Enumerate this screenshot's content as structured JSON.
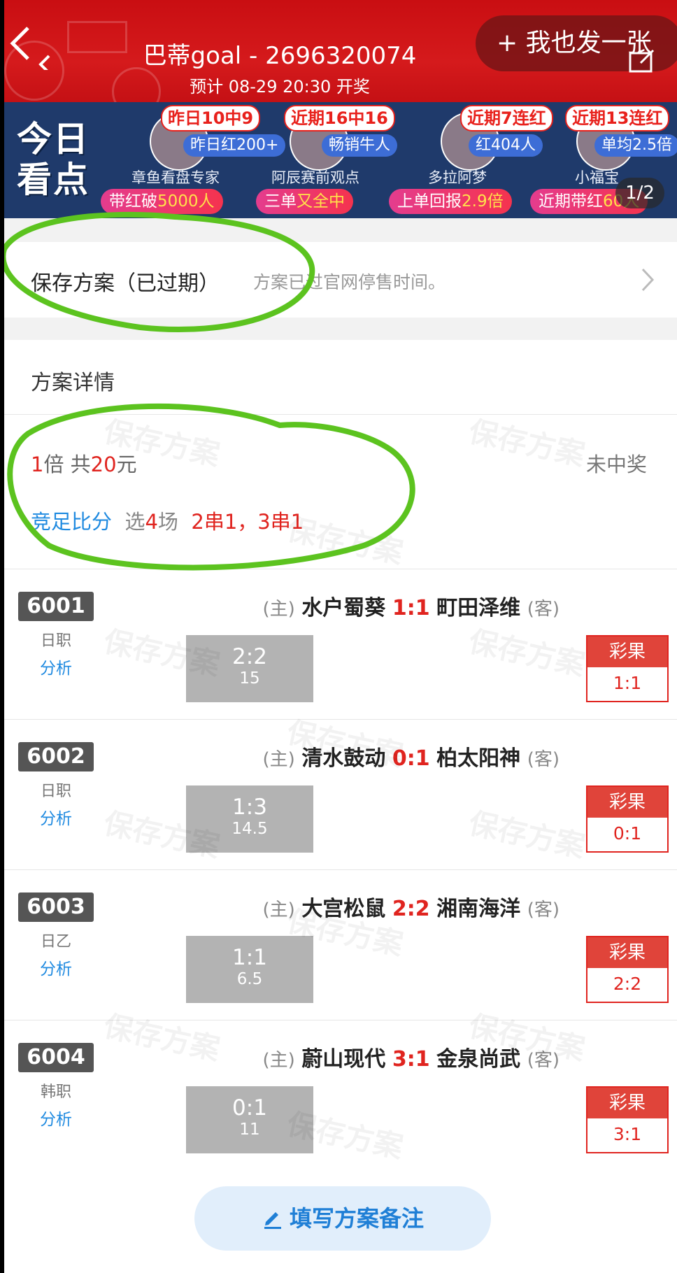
{
  "header": {
    "title": "巴蒂goal - 2696320074",
    "subtitle": "预计 08-29 20:30 开奖",
    "post_button": "+ 我也发一张"
  },
  "banner": {
    "headline_line1": "今日",
    "headline_line2": "看点",
    "experts": [
      {
        "tag": "昨日10中9",
        "stat": "昨日红200+",
        "name": "章鱼看盘专家"
      },
      {
        "tag": "近期16中16",
        "stat": "畅销牛人",
        "name": "阿辰赛前观点"
      },
      {
        "tag": "近期7连红",
        "stat": "红404人",
        "name": "多拉阿梦"
      },
      {
        "tag": "近期13连红",
        "stat": "单均2.5倍",
        "name": "小福宝"
      }
    ],
    "hot_tags": [
      {
        "pre": "带红破",
        "hl": "5000人"
      },
      {
        "pre": "三单",
        "hl": "又全中"
      },
      {
        "pre": "上单回报",
        "hl": "2.9倍"
      },
      {
        "pre": "近期带红",
        "hl": "60人"
      }
    ],
    "pager": "1/2"
  },
  "save": {
    "title": "保存方案（已过期）",
    "desc": "方案已过官网停售时间。"
  },
  "detail": {
    "title": "方案详情",
    "multiple": "1",
    "multiple_unit": "倍 共",
    "amount": "20",
    "amount_unit": "元",
    "status": "未中奖",
    "play_type": "竞足比分",
    "select_pre": "选",
    "select_count": "4",
    "select_unit": "场",
    "combos": "2串1，3串1"
  },
  "matches": [
    {
      "code": "6001",
      "league": "日职",
      "analysis": "分析",
      "home_tag": "(主)",
      "home": "水户蜀葵",
      "score": "1:1",
      "away": "町田泽维",
      "away_tag": "(客)",
      "pick_score": "2:2",
      "pick_odds": "15",
      "result_label": "彩果",
      "result": "1:1"
    },
    {
      "code": "6002",
      "league": "日职",
      "analysis": "分析",
      "home_tag": "(主)",
      "home": "清水鼓动",
      "score": "0:1",
      "away": "柏太阳神",
      "away_tag": "(客)",
      "pick_score": "1:3",
      "pick_odds": "14.5",
      "result_label": "彩果",
      "result": "0:1"
    },
    {
      "code": "6003",
      "league": "日乙",
      "analysis": "分析",
      "home_tag": "(主)",
      "home": "大宫松鼠",
      "score": "2:2",
      "away": "湘南海洋",
      "away_tag": "(客)",
      "pick_score": "1:1",
      "pick_odds": "6.5",
      "result_label": "彩果",
      "result": "2:2"
    },
    {
      "code": "6004",
      "league": "韩职",
      "analysis": "分析",
      "home_tag": "(主)",
      "home": "蔚山现代",
      "score": "3:1",
      "away": "金泉尚武",
      "away_tag": "(客)",
      "pick_score": "0:1",
      "pick_odds": "11",
      "result_label": "彩果",
      "result": "3:1"
    }
  ],
  "watermark": "保存方案",
  "footer": {
    "note_button": "填写方案备注"
  },
  "colors": {
    "header_red": "#c90e12",
    "accent_red": "#e0241f",
    "link_blue": "#1f8ae0",
    "annotation_green": "#5cc31f"
  },
  "icons": [
    "back-icon",
    "share-icon",
    "chevron-right-icon",
    "edit-icon"
  ]
}
